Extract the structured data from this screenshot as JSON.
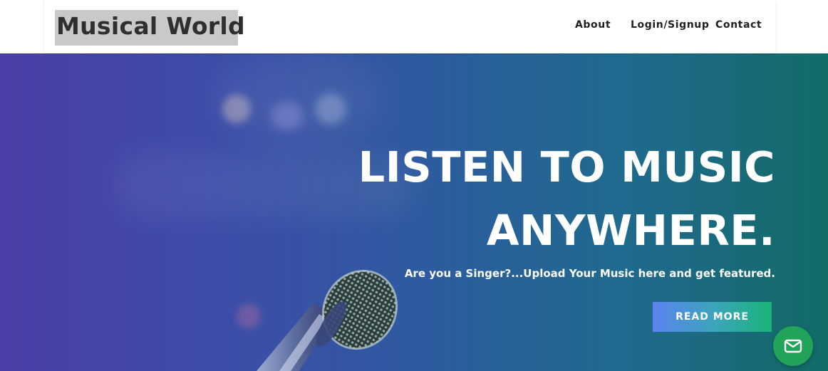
{
  "header": {
    "brand": "Musical World",
    "nav": [
      "About",
      "Login/Signup",
      "Contact"
    ]
  },
  "hero": {
    "title_line1": "LISTEN TO MUSIC",
    "title_line2": "ANYWHERE.",
    "subtitle": "Are you a Singer?...Upload Your Music here and get featured.",
    "cta_label": "READ MORE"
  },
  "widgets": {
    "chat_icon": "mail-icon"
  },
  "colors": {
    "hero_start": "#4a3fa6",
    "hero_end": "#156a6a",
    "cta_start": "#5b83f0",
    "cta_end": "#19b377",
    "fab": "#21a35a",
    "brand_bg": "#c9c9c9"
  }
}
